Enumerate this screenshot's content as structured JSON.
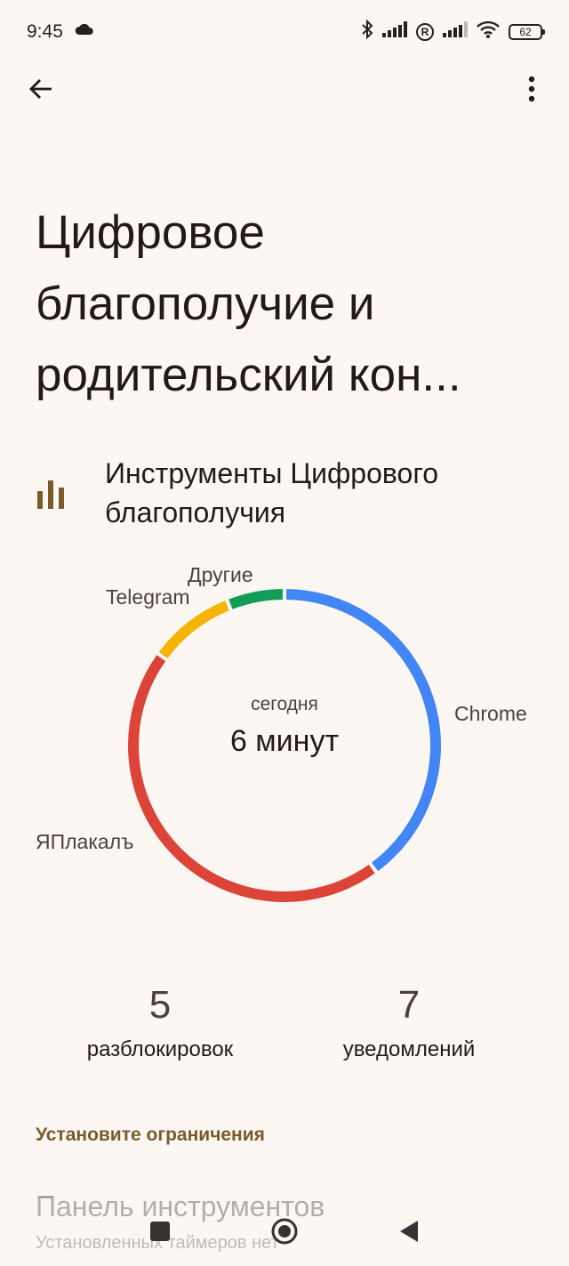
{
  "status_bar": {
    "time": "9:45",
    "battery": "62",
    "icons": [
      "cloud-icon",
      "bluetooth-icon",
      "signal-icon",
      "roaming-icon",
      "signal-icon",
      "wifi-icon",
      "battery-icon"
    ]
  },
  "app_bar": {
    "back_icon": "arrow-left-icon",
    "menu_icon": "more-vert-icon"
  },
  "page": {
    "title": "Цифровое благополучие и родительский кон..."
  },
  "section": {
    "icon": "bar-chart-icon",
    "title": "Инструменты Цифрового благополучия"
  },
  "usage_chart": {
    "center_sub": "сегодня",
    "center_main": "6 минут"
  },
  "chart_data": {
    "type": "pie",
    "title": "",
    "categories": [
      "Chrome",
      "ЯПлакалъ",
      "Telegram",
      "Другие"
    ],
    "values": [
      40,
      45,
      9,
      6
    ],
    "colors": [
      "#4285f4",
      "#db4437",
      "#f4b400",
      "#0f9d58"
    ],
    "legend": "labels-around-ring"
  },
  "stats": {
    "unlocks_value": "5",
    "unlocks_label": "разблокировок",
    "notifications_value": "7",
    "notifications_label": "уведомлений"
  },
  "limits": {
    "header": "Установите ограничения",
    "dashboard_title": "Панель инструментов",
    "dashboard_sub": "Установленных таймеров нет"
  },
  "colors": {
    "background": "#fdf7f4",
    "accent": "#7a5a2a"
  }
}
